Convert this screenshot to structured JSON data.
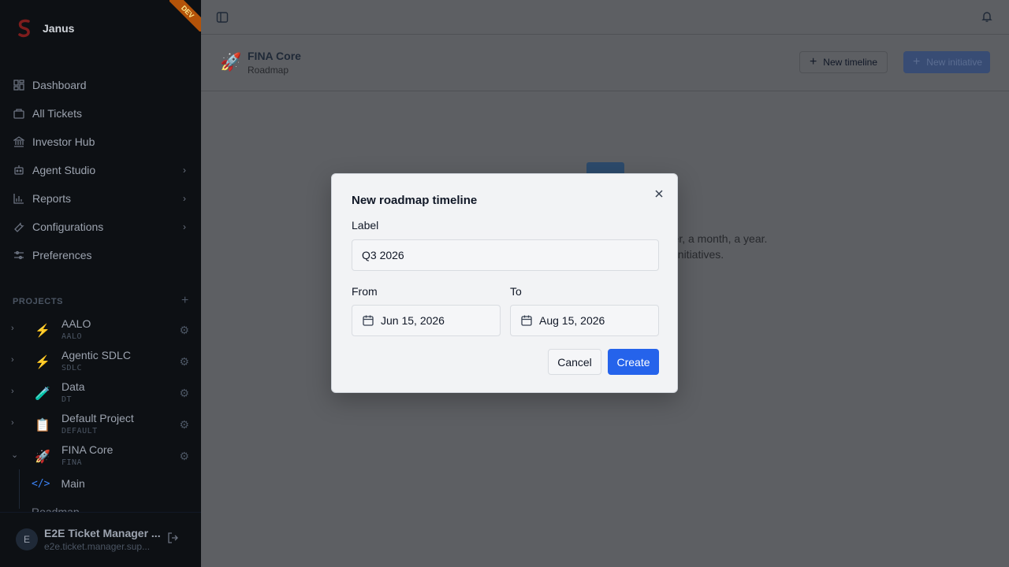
{
  "brand": {
    "name": "Janus",
    "env_badge": "DEV"
  },
  "nav": {
    "items": [
      {
        "label": "Dashboard",
        "icon": "dashboard-icon",
        "has_submenu": false
      },
      {
        "label": "All Tickets",
        "icon": "ticket-icon",
        "has_submenu": false
      },
      {
        "label": "Investor Hub",
        "icon": "bank-icon",
        "has_submenu": false
      },
      {
        "label": "Agent Studio",
        "icon": "bot-icon",
        "has_submenu": true
      },
      {
        "label": "Reports",
        "icon": "bar-chart-icon",
        "has_submenu": true
      },
      {
        "label": "Configurations",
        "icon": "wrench-icon",
        "has_submenu": true
      },
      {
        "label": "Preferences",
        "icon": "sliders-icon",
        "has_submenu": false
      }
    ]
  },
  "projects": {
    "header": "PROJECTS",
    "items": [
      {
        "title": "AALO",
        "key": "AALO",
        "icon": "⚡",
        "expanded": false
      },
      {
        "title": "Agentic SDLC",
        "key": "SDLC",
        "icon": "⚡",
        "expanded": false
      },
      {
        "title": "Data",
        "key": "DT",
        "icon": "🧪",
        "expanded": false
      },
      {
        "title": "Default Project",
        "key": "DEFAULT",
        "icon": "📋",
        "expanded": false
      },
      {
        "title": "FINA Core",
        "key": "FINA",
        "icon": "🚀",
        "expanded": true
      }
    ],
    "subitems": [
      {
        "label": "Main",
        "icon": "code-icon"
      },
      {
        "label": "Roadmap"
      }
    ]
  },
  "user": {
    "initial": "E",
    "name": "E2E Ticket Manager ...",
    "email": "e2e.ticket.manager.sup..."
  },
  "header": {
    "project_title": "FINA Core",
    "page": "Roadmap",
    "rocket": "🚀",
    "new_timeline_label": "New timeline",
    "new_initiative_label": "New initiative"
  },
  "empty_state": {
    "line1": "rter, a month, a year.",
    "line2": "g initiatives."
  },
  "dialog": {
    "title": "New roadmap timeline",
    "label_label": "Label",
    "label_value": "Q3 2026",
    "from_label": "From",
    "from_value": "Jun 15, 2026",
    "to_label": "To",
    "to_value": "Aug 15, 2026",
    "cancel_label": "Cancel",
    "create_label": "Create"
  },
  "colors": {
    "primary": "#2563eb",
    "sidebar_bg": "#0d1014",
    "overlay_bg": "#5d5f63"
  }
}
